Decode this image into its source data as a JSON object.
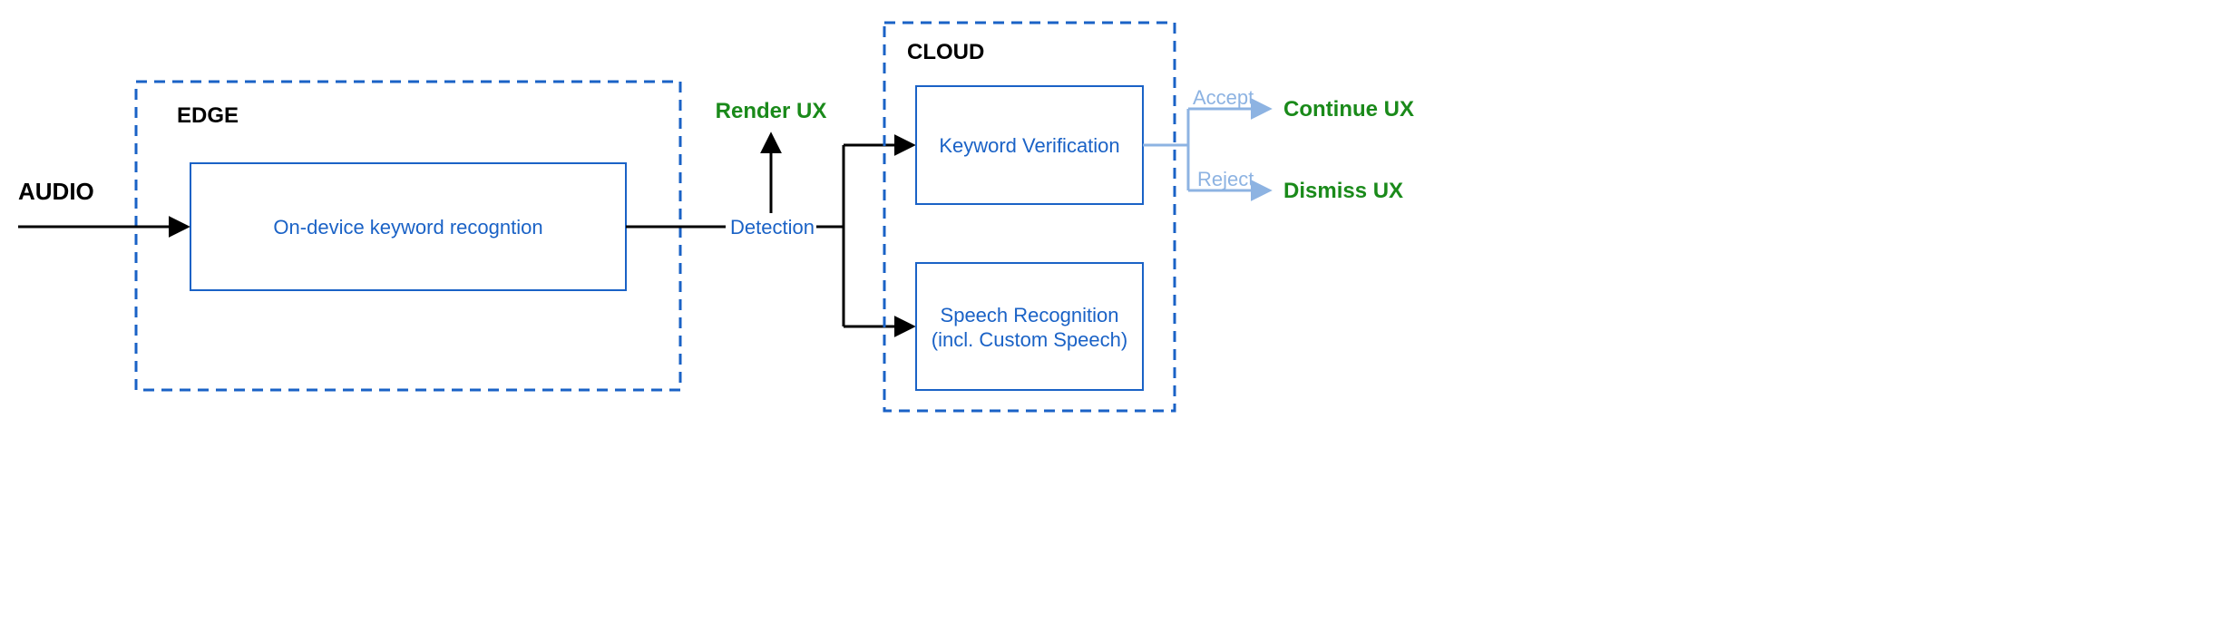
{
  "labels": {
    "audio": "AUDIO",
    "edge": "EDGE",
    "cloud": "CLOUD",
    "onDevice": "On-device keyword recogntion",
    "detection": "Detection",
    "renderUX": "Render UX",
    "keywordVerification": "Keyword Verification",
    "speechRecognitionLine1": "Speech Recognition",
    "speechRecognitionLine2": "(incl. Custom Speech)",
    "accept": "Accept",
    "reject": "Reject",
    "continueUX": "Continue UX",
    "dismissUX": "Dismiss UX"
  },
  "colors": {
    "blue": "#1a62c6",
    "lightBlue": "#8db3e2",
    "green": "#1a8a1a",
    "black": "#000000"
  }
}
